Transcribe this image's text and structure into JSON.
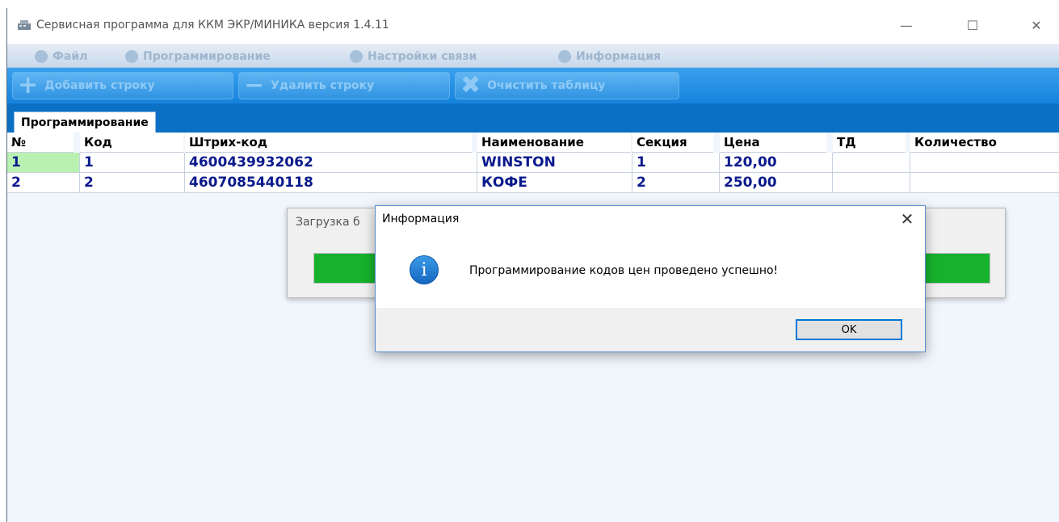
{
  "window": {
    "title": "Сервисная программа для ККМ ЭКР/МИНИКА версия 1.4.11",
    "minimize_glyph": "—",
    "maximize_glyph": "☐",
    "close_glyph": "✕"
  },
  "menu": {
    "items": [
      {
        "label": "Файл",
        "icon": "file-icon"
      },
      {
        "label": "Программирование",
        "icon": "programming-icon"
      },
      {
        "label": "Настройки связи",
        "icon": "connection-settings-icon"
      },
      {
        "label": "Информация",
        "icon": "info-icon"
      }
    ]
  },
  "toolbar": {
    "add_row_label": "Добавить строку",
    "delete_row_label": "Удалить строку",
    "clear_table_label": "Очистить таблицу"
  },
  "tabs": [
    {
      "label": "Программирование",
      "active": true
    }
  ],
  "table": {
    "columns": [
      "№",
      "Код",
      "Штрих-код",
      "Наименование",
      "Секция",
      "Цена",
      "ТД",
      "Количество"
    ],
    "rows": [
      [
        "1",
        "1",
        "4600439932062",
        "WINSTON",
        "1",
        "120,00",
        "",
        ""
      ],
      [
        "2",
        "2",
        "4607085440118",
        "КОФЕ",
        "2",
        "250,00",
        "",
        ""
      ]
    ],
    "selected_row": 0
  },
  "loading_window": {
    "title": "Загрузка б",
    "progress": 1.0,
    "progress_color": "#16b22d"
  },
  "dialog": {
    "title": "Информация",
    "close_glyph": "✕",
    "icon": "info-icon",
    "icon_glyph": "i",
    "message": "Программирование кодов цен проведено успешно!",
    "ok_label": "OK"
  },
  "colors": {
    "toolbar": "#1583dc",
    "tabstrip": "#0b6fc4",
    "cell_text": "#0b1a8c",
    "selected_cell": "#b9f2b0",
    "dialog_accent": "#0078d7"
  }
}
